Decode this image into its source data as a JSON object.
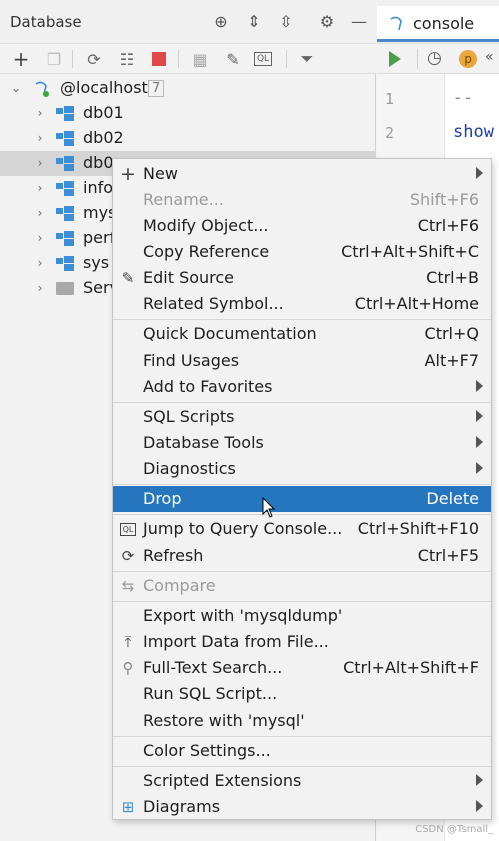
{
  "panel": {
    "title": "Database"
  },
  "tree": {
    "root_label": "@localhost",
    "root_count": "7",
    "items": [
      {
        "label": "db01"
      },
      {
        "label": "db02"
      },
      {
        "label": "db0"
      },
      {
        "label": "info"
      },
      {
        "label": "mys"
      },
      {
        "label": "perf"
      },
      {
        "label": "sys"
      },
      {
        "label": "Serv"
      }
    ]
  },
  "editor": {
    "tab_label": "console",
    "line_numbers": [
      "1",
      "2"
    ],
    "line1": "-- ",
    "line2": "show"
  },
  "menu": {
    "items": [
      {
        "label": "New",
        "shortcut": ""
      },
      {
        "label": "Rename...",
        "shortcut": "Shift+F6"
      },
      {
        "label": "Modify Object...",
        "shortcut": "Ctrl+F6"
      },
      {
        "label": "Copy Reference",
        "shortcut": "Ctrl+Alt+Shift+C"
      },
      {
        "label": "Edit Source",
        "shortcut": "Ctrl+B"
      },
      {
        "label": "Related Symbol...",
        "shortcut": "Ctrl+Alt+Home"
      },
      {
        "label": "Quick Documentation",
        "shortcut": "Ctrl+Q"
      },
      {
        "label": "Find Usages",
        "shortcut": "Alt+F7"
      },
      {
        "label": "Add to Favorites",
        "shortcut": ""
      },
      {
        "label": "SQL Scripts",
        "shortcut": ""
      },
      {
        "label": "Database Tools",
        "shortcut": ""
      },
      {
        "label": "Diagnostics",
        "shortcut": ""
      },
      {
        "label": "Drop",
        "shortcut": "Delete"
      },
      {
        "label": "Jump to Query Console...",
        "shortcut": "Ctrl+Shift+F10"
      },
      {
        "label": "Refresh",
        "shortcut": "Ctrl+F5"
      },
      {
        "label": "Compare",
        "shortcut": ""
      },
      {
        "label": "Export with 'mysqldump'",
        "shortcut": ""
      },
      {
        "label": "Import Data from File...",
        "shortcut": ""
      },
      {
        "label": "Full-Text Search...",
        "shortcut": "Ctrl+Alt+Shift+F"
      },
      {
        "label": "Run SQL Script...",
        "shortcut": ""
      },
      {
        "label": "Restore with 'mysql'",
        "shortcut": ""
      },
      {
        "label": "Color Settings...",
        "shortcut": ""
      },
      {
        "label": "Scripted Extensions",
        "shortcut": ""
      },
      {
        "label": "Diagrams",
        "shortcut": ""
      }
    ]
  },
  "colors": {
    "highlight": "#2675bf",
    "db_icon": "#3c8ed6",
    "run_green": "#4aa04a",
    "stop_red": "#e04848"
  },
  "watermark": "CSDN @Tsmall_"
}
